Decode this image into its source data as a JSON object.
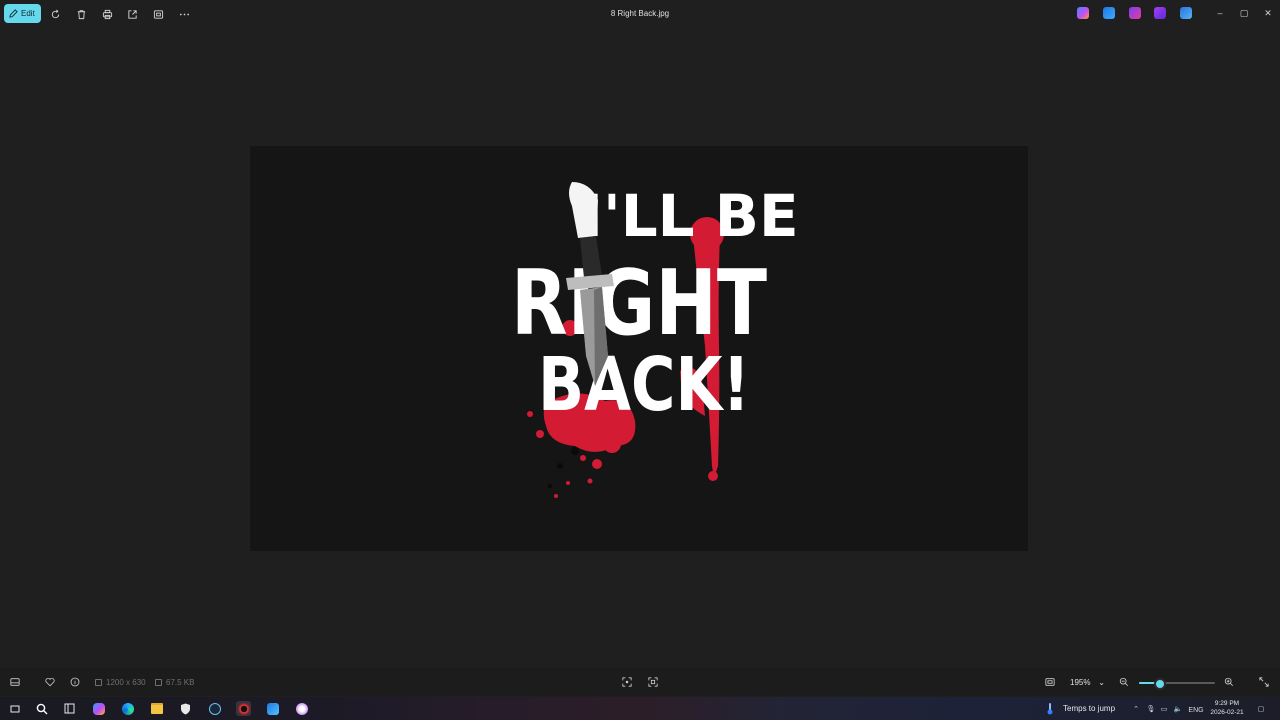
{
  "titlebar": {
    "edit_label": "Edit",
    "file_title": "8 Right Back.jpg",
    "tools": [
      "rotate-icon",
      "delete-icon",
      "print-icon",
      "share-icon",
      "crop-icon",
      "more-icon"
    ],
    "app_icons": [
      "copilot-icon",
      "paint-icon",
      "clipchamp-icon",
      "designer-icon",
      "onedrive-icon"
    ],
    "window_controls": {
      "minimize": "–",
      "maximize": "▢",
      "close": "✕"
    }
  },
  "image": {
    "line1": "I'LL BE",
    "line2": "RIGHT",
    "line3": "BACK!",
    "text_color": "#ffffff",
    "blood_color": "#d31b34",
    "background_color": "#151515"
  },
  "bottombar": {
    "dimensions": "1200 x 630",
    "file_size": "67.5 KB",
    "zoom_label": "195%",
    "zoom_fraction": 0.28
  },
  "taskbar": {
    "weather_label": "Temps to jump",
    "language": "ENG",
    "time": "9:29 PM",
    "date": "2026-02-21"
  },
  "colors": {
    "accent": "#66d8ec"
  }
}
